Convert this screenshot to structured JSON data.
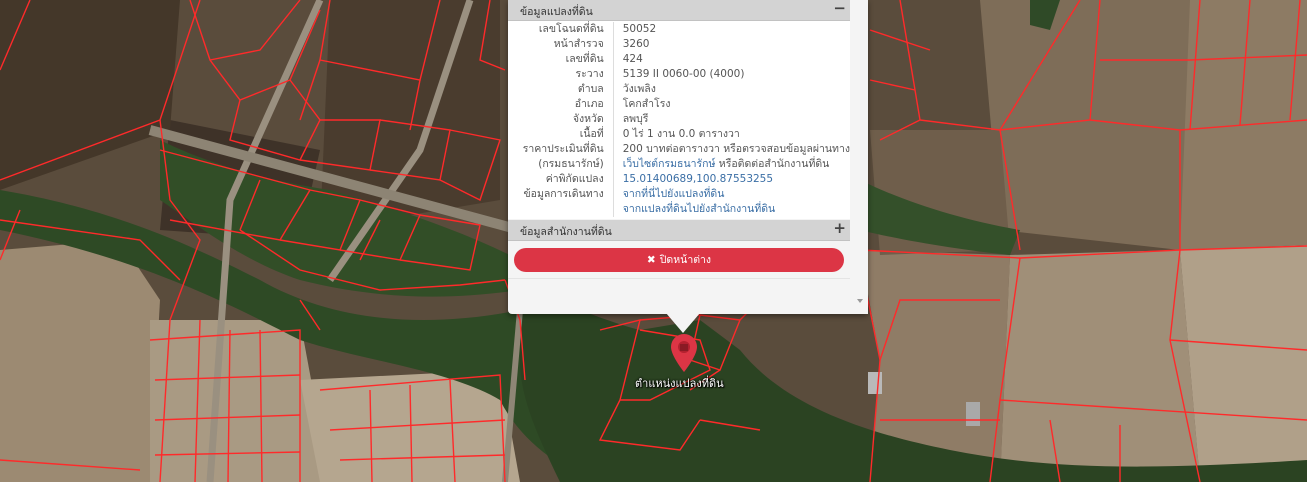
{
  "popup": {
    "land_info_title": "ข้อมูลแปลงที่ดิน",
    "land_info_toggle": "−",
    "office_title": "ข้อมูลสำนักงานที่ดิน",
    "office_toggle": "+",
    "close_label": "ปิดหน้าต่าง",
    "close_icon": "✖",
    "rows": [
      {
        "label": "เลขโฉนดที่ดิน",
        "value": "50052"
      },
      {
        "label": "หน้าสำรวจ",
        "value": "3260"
      },
      {
        "label": "เลขที่ดิน",
        "value": "424"
      },
      {
        "label": "ระวาง",
        "value": "5139 II 0060-00 (4000)"
      },
      {
        "label": "ตำบล",
        "value": "วังเพลิง"
      },
      {
        "label": "อำเภอ",
        "value": "โคกสำโรง"
      },
      {
        "label": "จังหวัด",
        "value": "ลพบุรี"
      },
      {
        "label": "เนื้อที่",
        "value": "0 ไร่ 1 งาน 0.0 ตารางวา"
      },
      {
        "label": "ราคาประเมินที่ดิน",
        "value": "200 บาทต่อตารางวา หรือตรวจสอบข้อมูลผ่านทาง"
      },
      {
        "label": "(กรมธนารักษ์)",
        "value": "เว็บไซต์กรมธนารักษ์",
        "value_suffix": " หรือติดต่อสำนักงานที่ดิน"
      },
      {
        "label": "ค่าพิกัดแปลง",
        "value": "15.01400689,100.87553255"
      },
      {
        "label": "ข้อมูลการเดินทาง",
        "value": "จากที่นี่ไปยังแปลงที่ดิน"
      },
      {
        "label": "",
        "value": "จากแปลงที่ดินไปยังสำนักงานที่ดิน"
      }
    ]
  },
  "marker": {
    "label": "ตำแหน่งแปลงที่ดิน",
    "icon": "map-pin-icon",
    "color": "#dc3545"
  },
  "colors": {
    "parcel_line": "#ff2a2a",
    "close_button": "#dc3545",
    "link": "#3a6ea5"
  }
}
